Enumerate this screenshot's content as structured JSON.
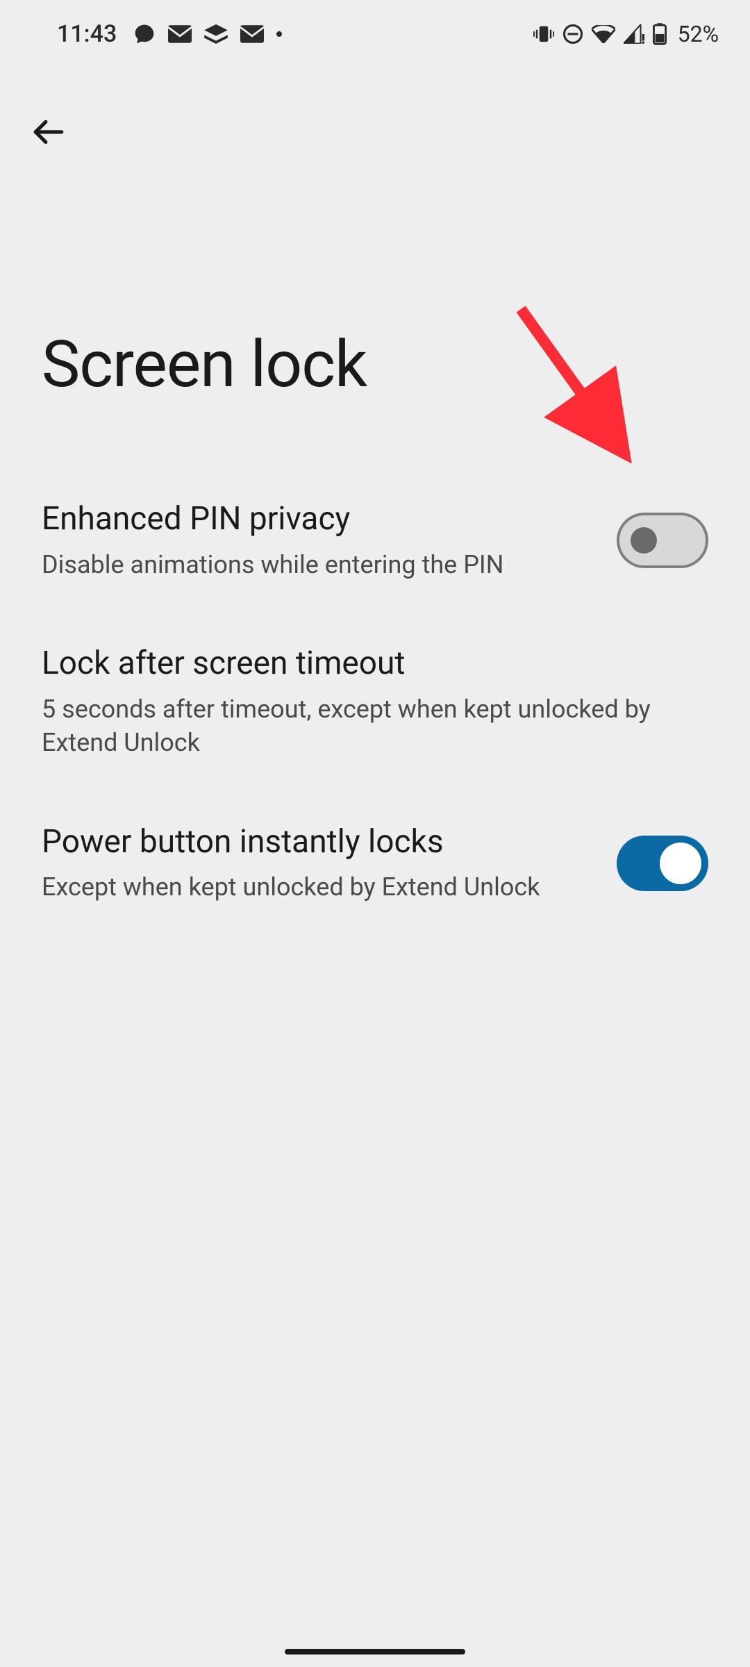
{
  "status": {
    "time": "11:43",
    "battery": "52%"
  },
  "page": {
    "title": "Screen lock"
  },
  "settings": [
    {
      "title": "Enhanced PIN privacy",
      "subtitle": "Disable animations while entering the PIN",
      "toggle": "off"
    },
    {
      "title": "Lock after screen timeout",
      "subtitle": "5 seconds after timeout, except when kept unlocked by Extend Unlock",
      "toggle": null
    },
    {
      "title": "Power button instantly locks",
      "subtitle": "Except when kept unlocked by Extend Unlock",
      "toggle": "on"
    }
  ],
  "colors": {
    "accent": "#0b6aa3",
    "annotation": "#fb2c36"
  }
}
